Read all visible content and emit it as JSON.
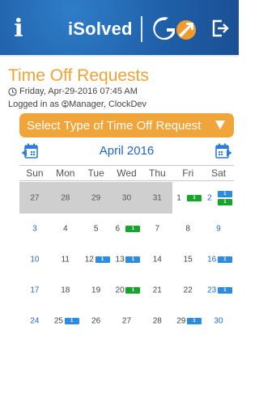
{
  "header": {
    "logo_text": "iSolved",
    "logo_go": "GO",
    "info_icon": "info-icon",
    "logout_icon": "logout-icon"
  },
  "page": {
    "title": "Time Off Requests",
    "datetime": "Friday, Apr-29-2016 07:45 AM",
    "logged_in_prefix": "Logged in as ",
    "logged_in_user": "Manager, ClockDev"
  },
  "select": {
    "label": "Select Type of Time Off Request"
  },
  "calendar": {
    "month_label": "April 2016",
    "weekdays": [
      "Sun",
      "Mon",
      "Tue",
      "Wed",
      "Thu",
      "Fri",
      "Sat"
    ],
    "weeks": [
      [
        {
          "day": "27",
          "prev_month": true,
          "badges": []
        },
        {
          "day": "28",
          "prev_month": true,
          "badges": []
        },
        {
          "day": "29",
          "prev_month": true,
          "badges": []
        },
        {
          "day": "30",
          "prev_month": true,
          "badges": []
        },
        {
          "day": "31",
          "prev_month": true,
          "badges": []
        },
        {
          "day": "1",
          "badges": [
            {
              "count": "1",
              "color": "green"
            }
          ]
        },
        {
          "day": "2",
          "weekend": true,
          "badges": [
            {
              "count": "1",
              "color": "blue"
            },
            {
              "count": "1",
              "color": "green"
            }
          ]
        }
      ],
      [
        {
          "day": "3",
          "weekend": true,
          "badges": []
        },
        {
          "day": "4",
          "badges": []
        },
        {
          "day": "5",
          "badges": []
        },
        {
          "day": "6",
          "badges": [
            {
              "count": "1",
              "color": "green"
            }
          ]
        },
        {
          "day": "7",
          "badges": []
        },
        {
          "day": "8",
          "badges": []
        },
        {
          "day": "9",
          "weekend": true,
          "badges": []
        }
      ],
      [
        {
          "day": "10",
          "weekend": true,
          "badges": []
        },
        {
          "day": "11",
          "badges": []
        },
        {
          "day": "12",
          "badges": [
            {
              "count": "1",
              "color": "blue"
            }
          ]
        },
        {
          "day": "13",
          "badges": [
            {
              "count": "1",
              "color": "blue"
            }
          ]
        },
        {
          "day": "14",
          "badges": []
        },
        {
          "day": "15",
          "badges": []
        },
        {
          "day": "16",
          "weekend": true,
          "badges": [
            {
              "count": "1",
              "color": "blue"
            }
          ]
        }
      ],
      [
        {
          "day": "17",
          "weekend": true,
          "badges": []
        },
        {
          "day": "18",
          "badges": []
        },
        {
          "day": "19",
          "badges": []
        },
        {
          "day": "20",
          "badges": [
            {
              "count": "1",
              "color": "green"
            }
          ]
        },
        {
          "day": "21",
          "badges": []
        },
        {
          "day": "22",
          "badges": []
        },
        {
          "day": "23",
          "weekend": true,
          "badges": [
            {
              "count": "1",
              "color": "blue"
            }
          ]
        }
      ],
      [
        {
          "day": "24",
          "weekend": true,
          "badges": []
        },
        {
          "day": "25",
          "badges": [
            {
              "count": "1",
              "color": "blue"
            }
          ]
        },
        {
          "day": "26",
          "badges": []
        },
        {
          "day": "27",
          "badges": []
        },
        {
          "day": "28",
          "badges": []
        },
        {
          "day": "29",
          "badges": [
            {
              "count": "1",
              "color": "blue"
            }
          ]
        },
        {
          "day": "30",
          "weekend": true,
          "badges": []
        }
      ]
    ]
  },
  "colors": {
    "header_blue": "#1f5fa8",
    "accent_orange": "#f0a53a",
    "title_orange": "#f2a234",
    "link_blue": "#1f68c8",
    "badge_blue": "#2c8be3",
    "badge_green": "#15a52b",
    "prev_month_gray": "#cfcfcf"
  }
}
